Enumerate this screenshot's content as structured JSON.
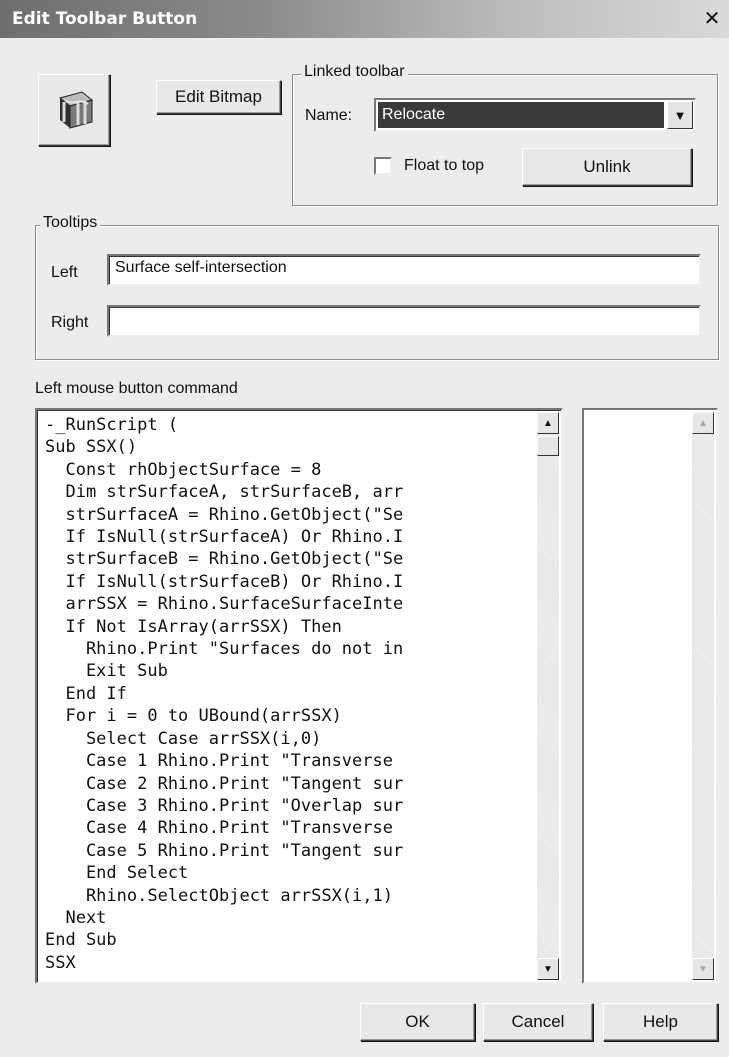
{
  "window": {
    "title": "Edit Toolbar Button",
    "close_glyph": "✕"
  },
  "bitmap": {
    "icon": "surface-self-intersection-icon",
    "edit_label": "Edit Bitmap"
  },
  "linked_toolbar": {
    "legend": "Linked toolbar",
    "name_label": "Name:",
    "name_value": "Relocate",
    "float_label": "Float to top",
    "float_checked": false,
    "unlink_label": "Unlink"
  },
  "tooltips": {
    "legend": "Tooltips",
    "left_label": "Left",
    "left_value": "Surface self-intersection",
    "right_label": "Right",
    "right_value": ""
  },
  "command": {
    "label": "Left mouse button command",
    "lines": [
      "-_RunScript (",
      "Sub SSX()",
      "  Const rhObjectSurface = 8",
      "  Dim strSurfaceA, strSurfaceB, arr",
      "  strSurfaceA = Rhino.GetObject(\"Se",
      "  If IsNull(strSurfaceA) Or Rhino.I",
      "  strSurfaceB = Rhino.GetObject(\"Se",
      "  If IsNull(strSurfaceB) Or Rhino.I",
      "  arrSSX = Rhino.SurfaceSurfaceInte",
      "  If Not IsArray(arrSSX) Then",
      "    Rhino.Print \"Surfaces do not in",
      "    Exit Sub",
      "  End If",
      "  For i = 0 to UBound(arrSSX)",
      "    Select Case arrSSX(i,0)",
      "    Case 1 Rhino.Print \"Transverse",
      "    Case 2 Rhino.Print \"Tangent sur",
      "    Case 3 Rhino.Print \"Overlap sur",
      "    Case 4 Rhino.Print \"Transverse",
      "    Case 5 Rhino.Print \"Tangent sur",
      "    End Select",
      "    Rhino.SelectObject arrSSX(i,1)",
      "  Next",
      "End Sub",
      "SSX"
    ]
  },
  "buttons": {
    "ok": "OK",
    "cancel": "Cancel",
    "help": "Help"
  }
}
